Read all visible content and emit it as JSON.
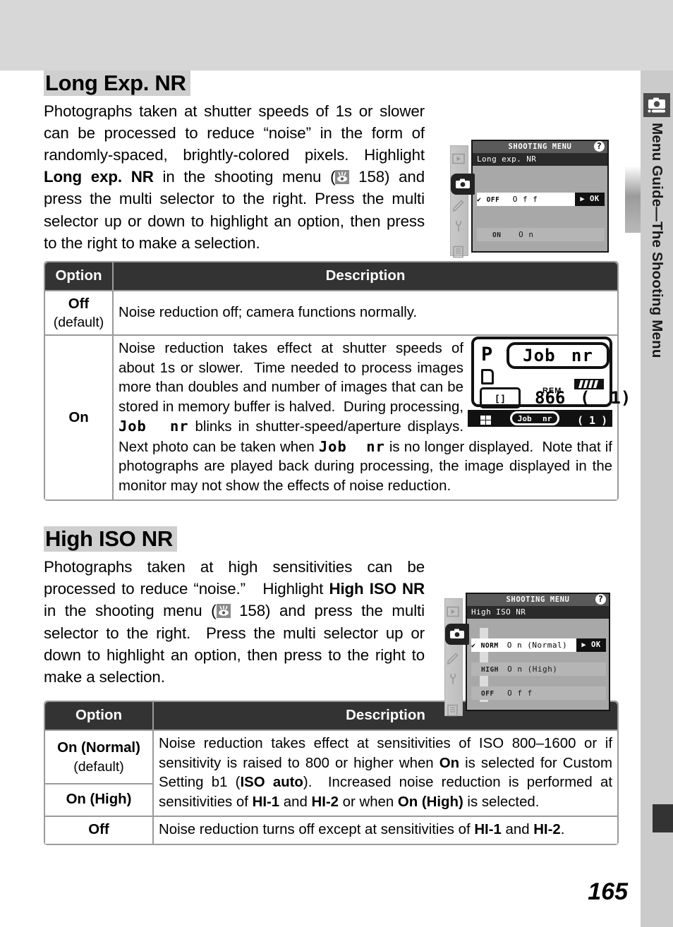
{
  "page": {
    "number": "165",
    "sidebar_label": "Menu Guide—The Shooting Menu",
    "sidebar_icon": "camera-icon"
  },
  "section1": {
    "title": "Long Exp. NR",
    "paragraph_parts": [
      {
        "t": "Photographs taken at shutter speeds of 1s or slower can be processed to reduce “noise” in the form of randomly-spaced, brightly-colored pixels. Highlight ",
        "b": false
      },
      {
        "t": "Long exp. NR",
        "b": true
      },
      {
        "t": " in the shooting menu (",
        "b": false
      },
      {
        "t": "ICON",
        "b": false
      },
      {
        "t": " 158) and press the multi selector to the right. Press the multi selector up or down to highlight an option, then press to the right to make a selection.",
        "b": false
      }
    ],
    "page_ref": "158",
    "menu_shot": {
      "title": "SHOOTING MENU",
      "help_icon": "?",
      "subtitle": "Long exp. NR",
      "ok_label": "OK",
      "rows": [
        {
          "check": "✔",
          "tag": "OFF",
          "label": "O f f",
          "selected": true
        },
        {
          "check": "",
          "tag": "ON",
          "label": "O n",
          "selected": false
        }
      ],
      "rail_icons": [
        "playback-icon",
        "camera-icon",
        "pencil-icon",
        "wrench-icon",
        "list-icon"
      ]
    },
    "table": {
      "headers": [
        "Option",
        "Description"
      ],
      "rows": [
        {
          "option": "Off",
          "option_note": "(default)",
          "shaded": true,
          "description": "Noise reduction off; camera functions normally."
        },
        {
          "option": "On",
          "option_note": "",
          "shaded": false,
          "description": "Noise reduction takes effect at shutter speeds of about 1s or slower.  Time needed to process images more than doubles and number of images that can be stored in memory buffer is halved.  During processing, Job nr blinks in shutter-speed/aperture displays. Next photo can be taken when Job nr is no longer displayed.  Note that if photographs are played back during processing, the image displayed in the monitor may not show the effects of noise reduction."
        }
      ]
    },
    "control_panel": {
      "mode": "P",
      "top_text_left": "Job",
      "top_text_right": "nr",
      "rem_label": "REM",
      "frames": "866",
      "buffer": "1",
      "strip_text_left": "Job",
      "strip_text_right": "nr",
      "strip_right": "1"
    }
  },
  "section2": {
    "title": "High ISO NR",
    "page_ref": "158",
    "menu_shot": {
      "title": "SHOOTING MENU",
      "help_icon": "?",
      "subtitle": "High ISO NR",
      "ok_label": "OK",
      "rows": [
        {
          "check": "✔",
          "tag": "NORM",
          "label": "O n  (Normal)",
          "selected": true
        },
        {
          "check": "",
          "tag": "HIGH",
          "label": "O n  (High)",
          "selected": false
        },
        {
          "check": "",
          "tag": "OFF",
          "label": "O f f",
          "selected": false
        }
      ],
      "rail_icons": [
        "playback-icon",
        "camera-icon",
        "pencil-icon",
        "wrench-icon",
        "list-icon"
      ]
    },
    "table": {
      "headers": [
        "Option",
        "Description"
      ],
      "rows": [
        {
          "option": "On (Normal)",
          "option_note": "(default)",
          "shaded": true
        },
        {
          "option": "On (High)",
          "option_note": "",
          "shaded": true
        },
        {
          "option": "Off",
          "option_note": "",
          "shaded": false
        }
      ],
      "desc_merged": "Noise reduction takes effect at sensitivities of ISO 800–1600 or if sensitivity is raised to 800 or higher when On is selected for Custom Setting b1 (ISO auto).  Increased noise reduction is performed at sensitivities of HI-1 and HI-2 or when On (High) is selected.",
      "desc_off": "Noise reduction turns off except at sensitivities of HI-1 and HI-2."
    }
  }
}
